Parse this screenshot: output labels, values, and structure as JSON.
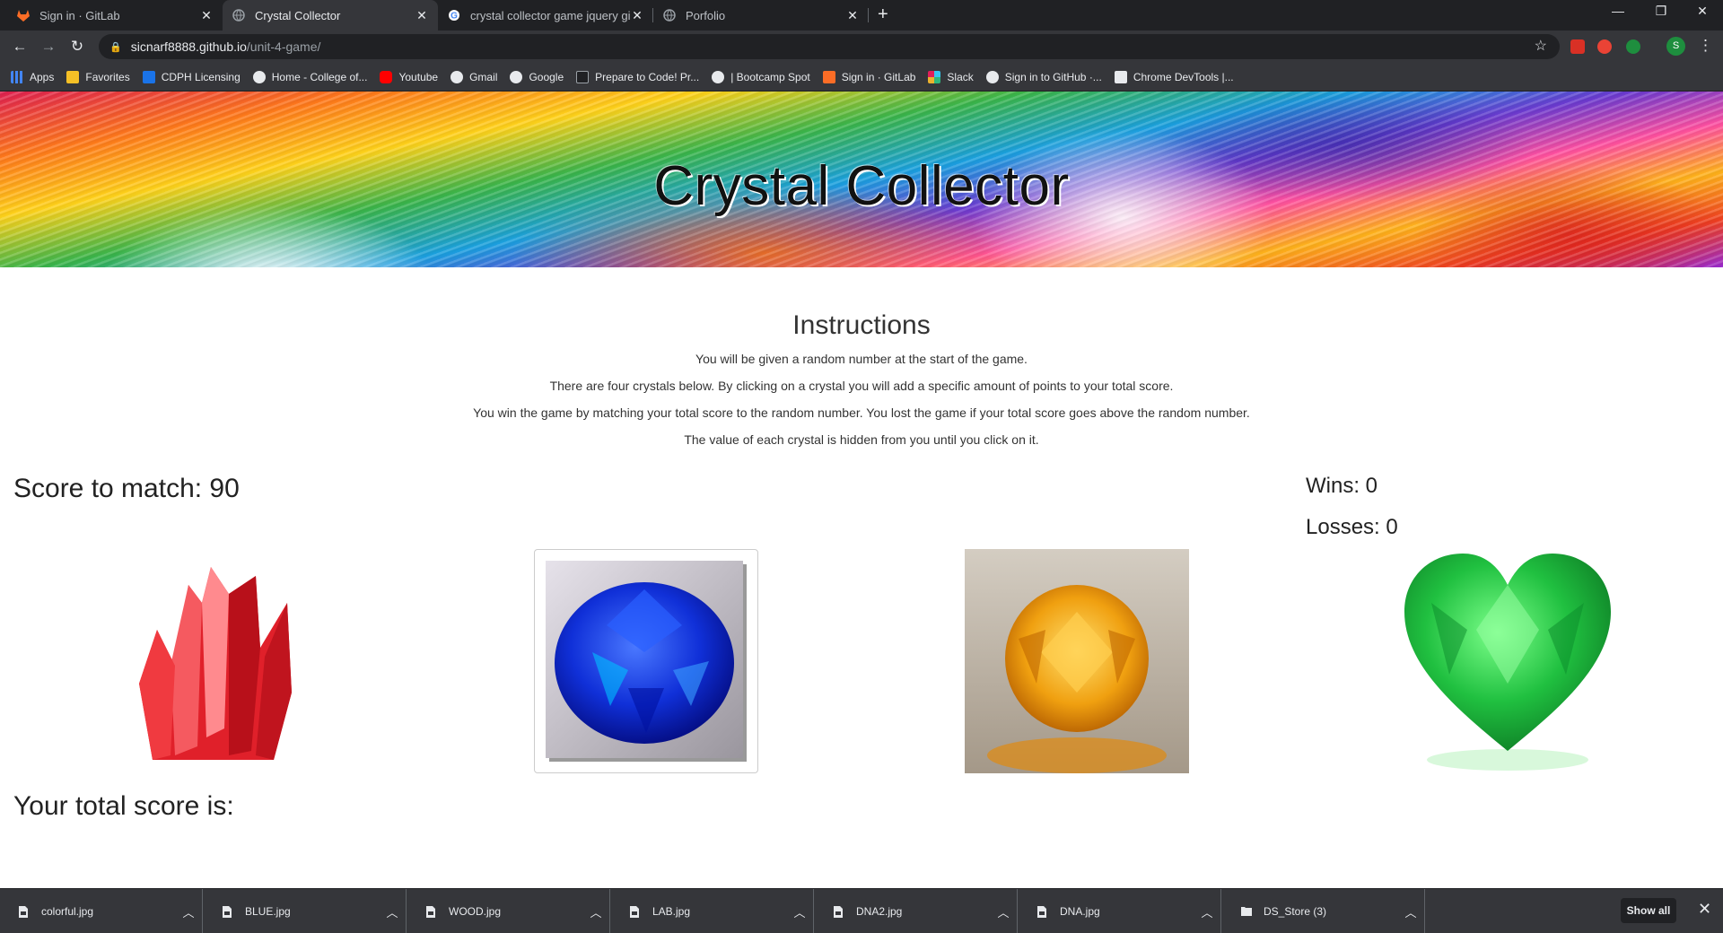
{
  "browser": {
    "tabs": [
      {
        "title": "Sign in · GitLab",
        "icon": "gitlab-icon",
        "active": false
      },
      {
        "title": "Crystal Collector",
        "icon": "globe-icon",
        "active": true
      },
      {
        "title": "crystal collector game jquery gith",
        "icon": "google-icon",
        "active": false
      },
      {
        "title": "Porfolio",
        "icon": "globe-icon",
        "active": false
      }
    ],
    "url_host": "sicnarf8888.github.io",
    "url_path": "/unit-4-game/",
    "profile_initial": "S",
    "bookmarks": [
      {
        "label": "Apps",
        "color": "#4285f4"
      },
      {
        "label": "Favorites",
        "color": "#f6c026"
      },
      {
        "label": "CDPH Licensing",
        "color": "#1a73e8"
      },
      {
        "label": "Home - College of...",
        "color": "#e8eaed"
      },
      {
        "label": "Youtube",
        "color": "#ff0000"
      },
      {
        "label": "Gmail",
        "color": "#e8eaed"
      },
      {
        "label": "Google",
        "color": "#e8eaed"
      },
      {
        "label": "Prepare to Code! Pr...",
        "color": "#202124"
      },
      {
        "label": "| Bootcamp Spot",
        "color": "#e8eaed"
      },
      {
        "label": "Sign in · GitLab",
        "color": "#fc6d26"
      },
      {
        "label": "Slack",
        "color": "#36c5f0"
      },
      {
        "label": "Sign in to GitHub ·...",
        "color": "#e8eaed"
      },
      {
        "label": "Chrome DevTools |...",
        "color": "#e8eaed"
      }
    ]
  },
  "page": {
    "title": "Crystal Collector",
    "instructions_heading": "Instructions",
    "instructions": [
      "You will be given a random number at the start of the game.",
      "There are four crystals below. By clicking on a crystal you will add a specific amount of points to your total score.",
      "You win the game by matching your total score to the random number. You lost the game if your total score goes above the random number.",
      "The value of each crystal is hidden from you until you click on it."
    ],
    "score_to_match": "Score to match: 90",
    "wins": "Wins: 0",
    "losses": "Losses: 0",
    "total_score": "Your total score is:",
    "colors": {
      "red": "#e0202a",
      "blue": "#1a3ae0",
      "yellow": "#f0a010",
      "green": "#20c040"
    }
  },
  "downloads": {
    "items": [
      "colorful.jpg",
      "BLUE.jpg",
      "WOOD.jpg",
      "LAB.jpg",
      "DNA2.jpg",
      "DNA.jpg",
      "DS_Store (3)"
    ],
    "show_all": "Show all"
  }
}
